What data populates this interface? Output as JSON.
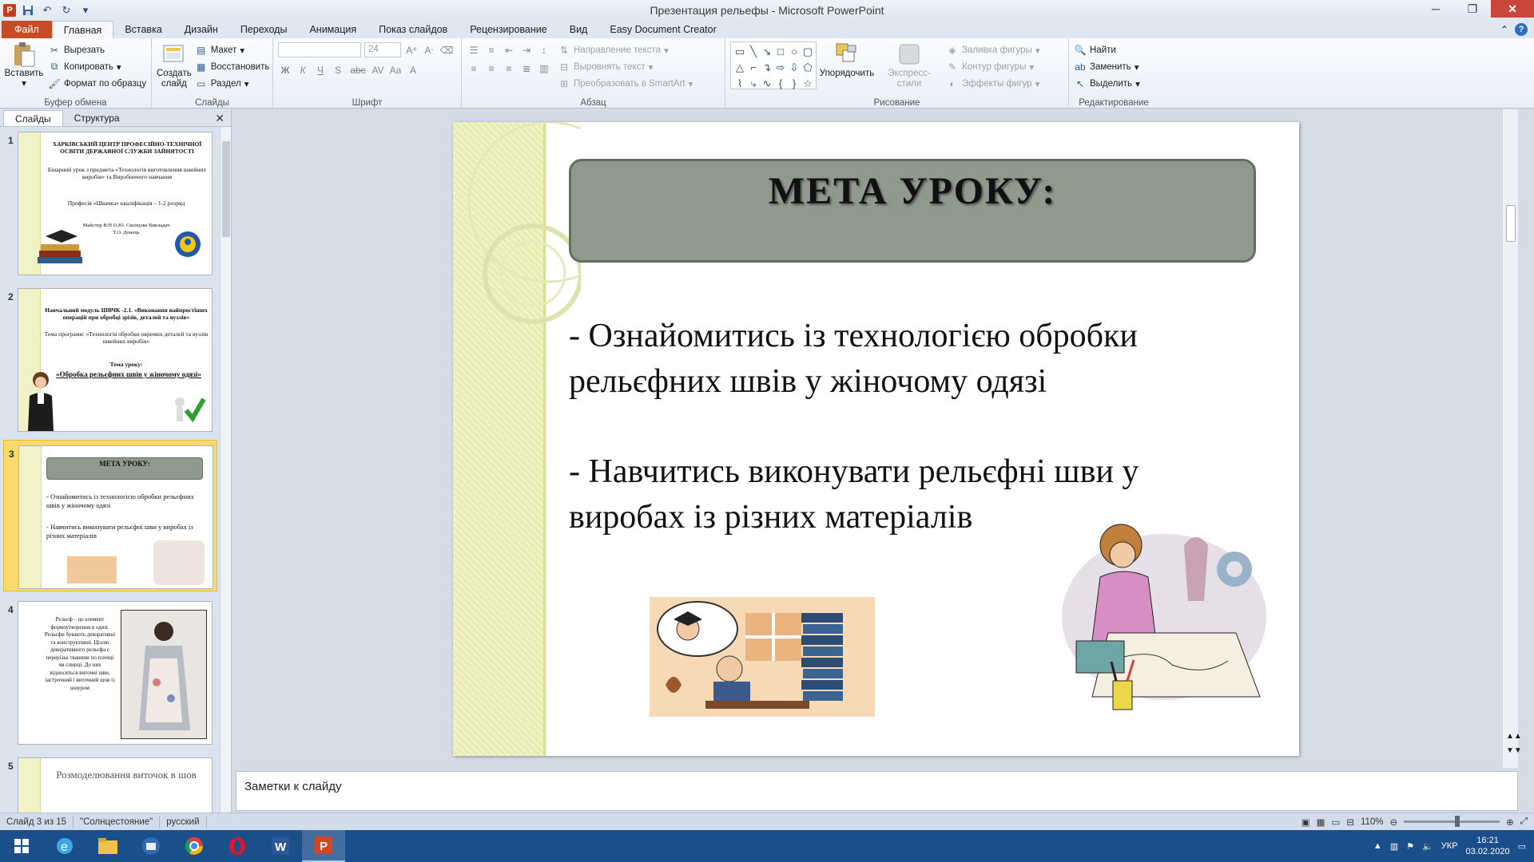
{
  "window": {
    "title": "Презентация рельефы - Microsoft PowerPoint"
  },
  "tabs": [
    "Файл",
    "Главная",
    "Вставка",
    "Дизайн",
    "Переходы",
    "Анимация",
    "Показ слайдов",
    "Рецензирование",
    "Вид",
    "Easy Document Creator"
  ],
  "ribbon": {
    "clipboard": {
      "paste": "Вставить",
      "cut": "Вырезать",
      "copy": "Копировать",
      "format_painter": "Формат по образцу",
      "label": "Буфер обмена"
    },
    "slides": {
      "new_slide": "Создать слайд",
      "layout": "Макет",
      "reset": "Восстановить",
      "section": "Раздел",
      "label": "Слайды"
    },
    "font": {
      "size": "24",
      "label": "Шрифт",
      "bold": "Ж",
      "italic": "К",
      "underline": "Ч",
      "strike": "S",
      "abc": "abc"
    },
    "paragraph": {
      "text_direction": "Направление текста",
      "align_text": "Выровнять текст",
      "smartart": "Преобразовать в SmartArt",
      "label": "Абзац"
    },
    "drawing": {
      "arrange": "Упорядочить",
      "quick_styles": "Экспресс-стили",
      "fill": "Заливка фигуры",
      "outline": "Контур фигуры",
      "effects": "Эффекты фигур",
      "label": "Рисование"
    },
    "editing": {
      "find": "Найти",
      "replace": "Заменить",
      "select": "Выделить",
      "label": "Редактирование"
    }
  },
  "pane": {
    "tab_slides": "Слайды",
    "tab_outline": "Структура"
  },
  "thumbnails": [
    {
      "num": "1",
      "title": "ХАРКІВСЬКИЙ ЦЕНТР ПРОФЕСІЙНО-ТЕХНІЧНОЇ ОСВІТИ ДЕРЖАВНОЇ СЛУЖБИ ЗАЙНЯТОСТІ",
      "line1": "Бінарний урок з предмета «Технологія виготовлення швейних виробів» та Виробничого навчання",
      "line2": "Професія «Швачка» кваліфікація – 1-2 розряд",
      "line3": "Майстер В/Н О.Ю. Скопцова Викладач Т.О. Донець"
    },
    {
      "num": "2",
      "title": "Навчальний модуль ШВЧК -2.1. «Виконання найпростіших операцій при обробці зрізів, деталей та вузлів»",
      "line1": "Тема програми: «Технологія обробки окремих деталей та вузлів швейних виробів»",
      "line2": "Тема уроку:",
      "line3": "«Обробка рельєфних швів у жіночому одязі»"
    },
    {
      "num": "3",
      "title": "МЕТА УРОКУ:",
      "line1": "- Ознайомитись із технологією обробки рельєфних швів у жіночому одязі",
      "line2": "- Навчитись виконувати рельєфні шви у виробах із різних матеріалів"
    },
    {
      "num": "4",
      "line1": "Рельєф – це елемент формоутворення в одязі. Рельєфи бувають декоративні та конструктивні. Ціллю декоративного рельєфа є перерізка тканини по плочці чи спинці. До них відносяться виточні шви, застрочний і виточний шов із шнуром"
    },
    {
      "num": "5",
      "title": "Розмоделювання виточок в шов"
    }
  ],
  "slide": {
    "title": "МЕТА УРОКУ:",
    "bullet1": "- Ознайомитись із технологією обробки рельєфних швів у жіночому одязі",
    "bullet2": "- Навчитись виконувати рельєфні шви у виробах із різних матеріалів"
  },
  "notes": {
    "placeholder": "Заметки к слайду"
  },
  "status": {
    "slide_counter": "Слайд 3 из 15",
    "theme": "\"Солнцестояние\"",
    "language": "русский",
    "zoom": "110%"
  },
  "taskbar": {
    "lang": "УКР",
    "time": "16:21",
    "date": "03.02.2020"
  },
  "colors": {
    "title_box": "#8f9a8d",
    "file_tab": "#c64c28",
    "taskbar": "#1b4f8b",
    "selected_thumb": "#fbd96a"
  }
}
